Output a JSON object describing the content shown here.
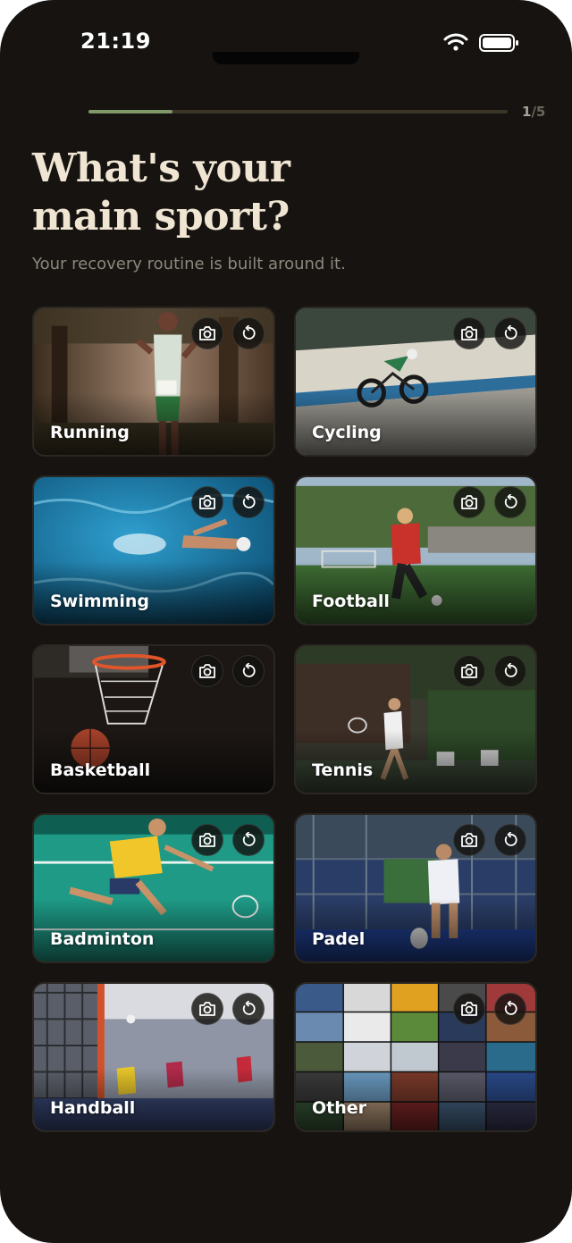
{
  "status_bar": {
    "time": "21:19"
  },
  "progress": {
    "current": "1",
    "separator": "/",
    "total": "5",
    "fraction": 0.2
  },
  "header": {
    "title": "What's your main sport?",
    "subtitle": "Your recovery routine is built around it."
  },
  "sports": [
    {
      "label": "Running"
    },
    {
      "label": "Cycling"
    },
    {
      "label": "Swimming"
    },
    {
      "label": "Football"
    },
    {
      "label": "Basketball"
    },
    {
      "label": "Tennis"
    },
    {
      "label": "Badminton"
    },
    {
      "label": "Padel"
    },
    {
      "label": "Handball"
    },
    {
      "label": "Other"
    }
  ],
  "icons": {
    "photo": "camera-icon",
    "reset": "rotate-ccw-icon"
  },
  "colors": {
    "background": "#161310",
    "accent": "#7f9a68",
    "title": "#efe5d2"
  }
}
